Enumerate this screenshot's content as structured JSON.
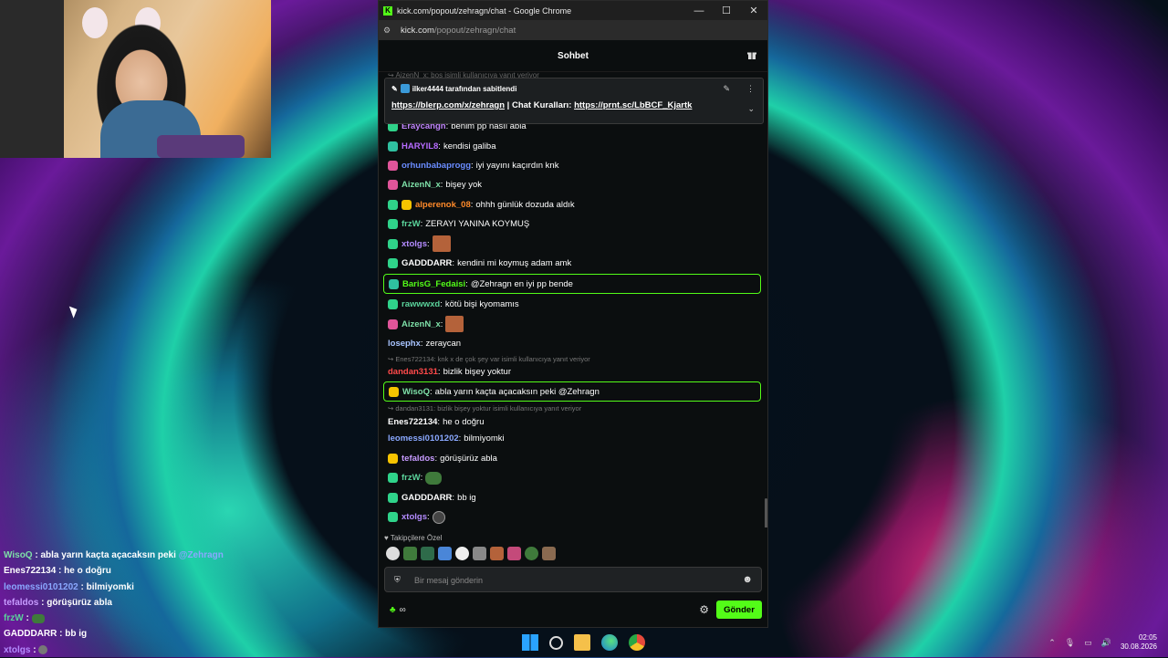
{
  "window": {
    "title": "kick.com/popout/zehragn/chat - Google Chrome",
    "url_host": "kick.com",
    "url_path": "/popout/zehragn/chat"
  },
  "chat": {
    "header": "Sohbet",
    "faded_line": "↪ AizenN_x: bos isimli kullanıcıya yanıt veriyor",
    "pinned": {
      "by": "ilker4444 tarafından sabitlendi",
      "link1": "https://blerp.com/x/zehragn",
      "sep": " | Chat Kuralları: ",
      "link2": "https://prnt.sc/LbBCF_Kjartk"
    },
    "messages": [
      {
        "user": "Eraycangn",
        "text": "benim pp nasıl abla"
      },
      {
        "user": "HARYIL8",
        "text": "kendisi galiba"
      },
      {
        "user": "orhunbabaprogg",
        "text": "iyi yayını kaçırdın knk"
      },
      {
        "user": "AizenN_x",
        "text": "bişey yok"
      },
      {
        "user": "alperenok_08",
        "text": "ohhh günlük dozuda aldık"
      },
      {
        "user": "frzW",
        "text": "ZERAYI YANINA KOYMUŞ"
      },
      {
        "user": "xtolgs",
        "text": ""
      },
      {
        "user": "GADDDARR",
        "text": "kendini mi koymuş adam amk"
      },
      {
        "user": "BarisG_Fedaisi",
        "text": "@Zehragn en iyi pp bende"
      },
      {
        "user": "rawwwxd",
        "text": "kötü bişi kyomamıs"
      },
      {
        "user": "AizenN_x",
        "text": ""
      },
      {
        "user": "losephx",
        "text": "zeraycan"
      },
      {
        "reply": "↪ Enes722134: knk x de çok şey var isimli kullanıcıya yanıt veriyor"
      },
      {
        "user": "dandan3131",
        "text": "bizlik bişey yoktur"
      },
      {
        "user": "WisoQ",
        "text": "abla yarın kaçta açacaksın peki @Zehragn"
      },
      {
        "reply": "↪ dandan3131: bizlik bişey yoktur isimli kullanıcıya yanıt veriyor"
      },
      {
        "user": "Enes722134",
        "text": "he o doğru"
      },
      {
        "user": "leomessi0101202",
        "text": "bilmiyomki"
      },
      {
        "user": "tefaldos",
        "text": "görüşürüz abla"
      },
      {
        "user": "frzW",
        "text": ""
      },
      {
        "user": "GADDDARR",
        "text": "bb ig"
      },
      {
        "user": "xtolgs",
        "text": ""
      }
    ],
    "followers_label": "Takipçilere Özel",
    "input_placeholder": "Bir mesaj gönderin",
    "send_label": "Gönder"
  },
  "overlay": [
    {
      "user": "WisoQ",
      "text": "abla yarın kaçta açacaksın peki",
      "mention": "@Zehragn",
      "color": "#7ee0a8"
    },
    {
      "user": "Enes722134",
      "text": "he o doğru",
      "color": "#ffffff"
    },
    {
      "user": "leomessi0101202",
      "text": "bilmiyomki",
      "color": "#8aa8ff"
    },
    {
      "user": "tefaldos",
      "text": "görüşürüz abla",
      "color": "#c79bff"
    },
    {
      "user": "frzW",
      "text": "",
      "color": "#5ad29a"
    },
    {
      "user": "GADDDARR",
      "text": "bb ig",
      "color": "#ffffff"
    },
    {
      "user": "xtolgs",
      "text": "",
      "color": "#b48bff"
    }
  ],
  "taskbar": {
    "time": "02:05",
    "date": "30.08.2026"
  },
  "colors": {
    "accent": "#53fc18"
  }
}
